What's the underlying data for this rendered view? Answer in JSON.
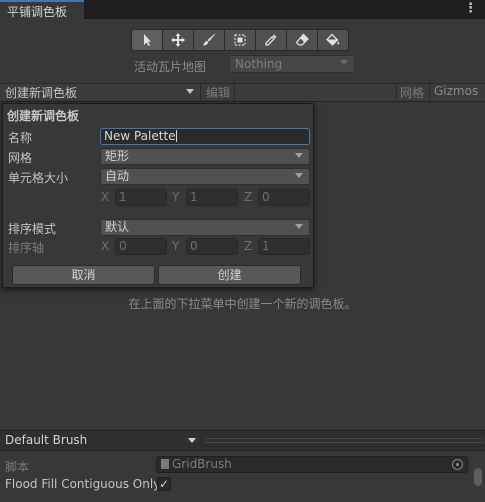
{
  "window": {
    "tab_title": "平铺调色板",
    "menu_glyph": "⋮"
  },
  "toolbar": {
    "tools": [
      {
        "icon": "arrow-select-icon"
      },
      {
        "icon": "move-icon"
      },
      {
        "icon": "paint-brush-icon"
      },
      {
        "icon": "box-fill-icon"
      },
      {
        "icon": "eyedropper-icon"
      },
      {
        "icon": "eraser-icon"
      },
      {
        "icon": "bucket-fill-icon"
      }
    ],
    "active_tilemap_label": "活动瓦片地图",
    "active_tilemap_value": "Nothing"
  },
  "palette_bar": {
    "palette_dropdown": "创建新调色板",
    "edit_label": "编辑",
    "grid_label": "网格",
    "gizmos_label": "Gizmos"
  },
  "popup": {
    "title": "创建新调色板",
    "name_label": "名称",
    "name_value": "New Palette",
    "grid_label": "网格",
    "grid_value": "矩形",
    "cell_size_label": "单元格大小",
    "cell_size_value": "自动",
    "cell_size_xyz": {
      "x_label": "X",
      "x": "1",
      "y_label": "Y",
      "y": "1",
      "z_label": "Z",
      "z": "0"
    },
    "sort_mode_label": "排序模式",
    "sort_mode_value": "默认",
    "sort_axis_label": "排序轴",
    "sort_axis_xyz": {
      "x_label": "X",
      "x": "0",
      "y_label": "Y",
      "y": "0",
      "z_label": "Z",
      "z": "1"
    },
    "cancel_label": "取消",
    "create_label": "创建"
  },
  "hint": "在上面的下拉菜单中创建一个新的调色板。",
  "brush": {
    "brush_dropdown": "Default Brush",
    "script_label": "脚本",
    "script_value": "GridBrush",
    "flood_fill_label": "Flood Fill Contiguous Only",
    "flood_fill_checked": "✓"
  },
  "colors": {
    "accent": "#3a79bb",
    "background": "#383838",
    "text": "#c4c4c4"
  }
}
